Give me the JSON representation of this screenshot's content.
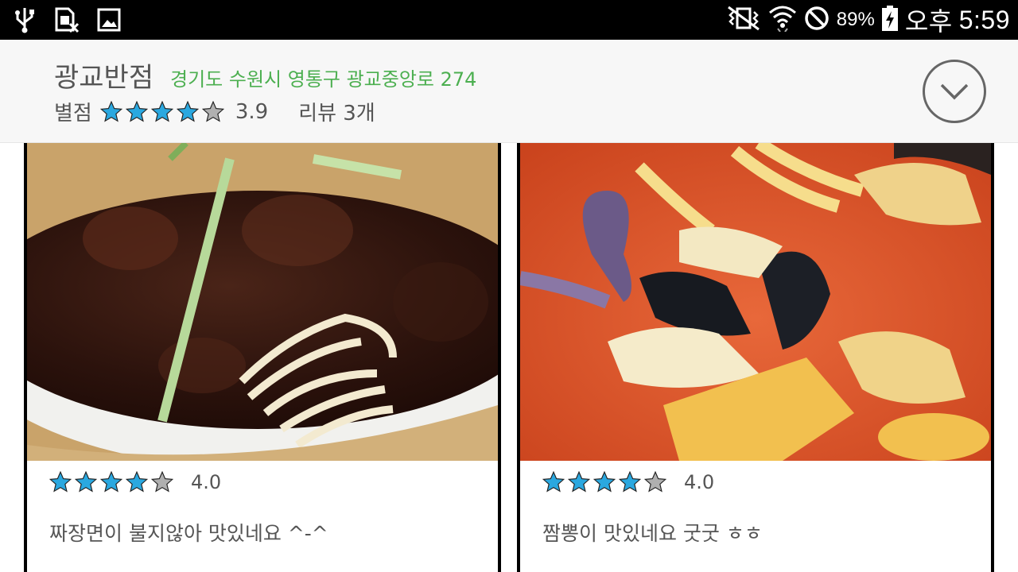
{
  "status_bar": {
    "left_icons": [
      "usb-icon",
      "sim-card-off-icon",
      "image-icon"
    ],
    "right_icons": [
      "vibrate-icon",
      "wifi-icon",
      "do-not-disturb-icon",
      "battery-charging-icon"
    ],
    "battery": "89%",
    "ampm": "오후",
    "time": "5:59"
  },
  "restaurant": {
    "name": "광교반점",
    "address": "경기도 수원시 영통구 광교중앙로 274",
    "rating_label": "별점",
    "rating": "3.9",
    "rating_stars": 3.9,
    "reviews": "리뷰 3개"
  },
  "colors": {
    "accent_green": "#4caf50",
    "star_filled": "#2aa8e0",
    "star_empty": "#b0b0b0"
  },
  "reviews": [
    {
      "rating": "4.0",
      "stars": 4,
      "comment": "짜장면이 불지않아 맛있네요 ^-^",
      "photo": "jajangmyeon-photo"
    },
    {
      "rating": "4.0",
      "stars": 4,
      "comment": "짬뽕이 맛있네요 굿굿 ㅎㅎ",
      "photo": "jjamppong-photo"
    }
  ]
}
